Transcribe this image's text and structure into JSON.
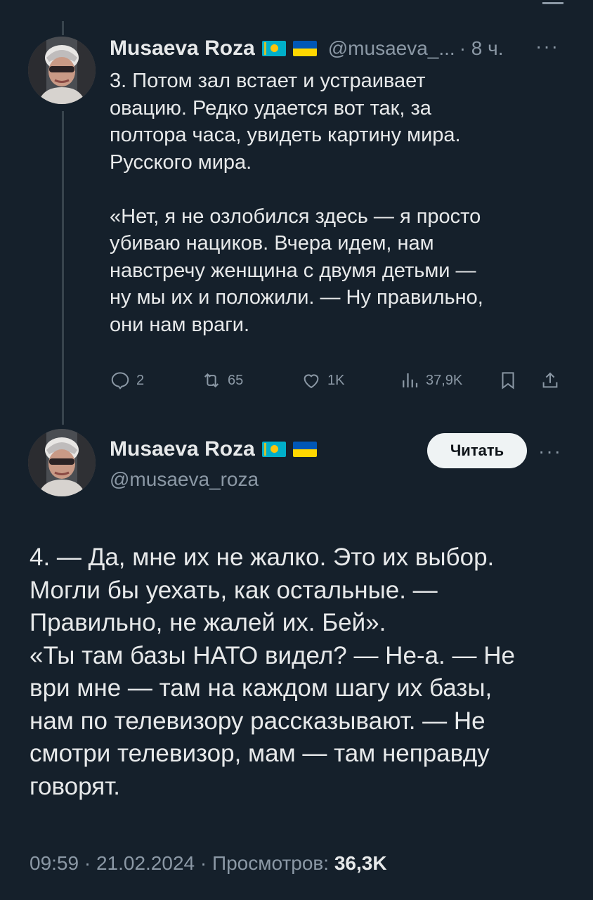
{
  "reply_tweet": {
    "author_name": "Musaeva Roza",
    "handle": "@musaeva_...",
    "time": "· 8 ч.",
    "more": "···",
    "text": "3. Потом зал встает и устраивает\nовацию. Редко удается вот так, за\nполтора часа, увидеть картину мира.\nРусского мира.\n\n«Нет, я не озлобился здесь — я просто\nубиваю нациков. Вчера идем, нам\nнавстречу женщина с двумя детьми —\nну мы их и положили. — Ну правильно,\nони нам враги.",
    "actions": {
      "replies": "2",
      "retweets": "65",
      "likes": "1K",
      "views": "37,9K"
    }
  },
  "main_tweet": {
    "author_name": "Musaeva Roza",
    "handle": "@musaeva_roza",
    "follow_label": "Читать",
    "more": "···",
    "text": "4. — Да, мне их не жалко. Это их выбор.\nМогли бы уехать, как остальные. —\nПравильно, не жалей их. Бей».\n«Ты там базы НАТО видел? — Не-а. — Не\nври мне — там на каждом шагу их базы,\nнам по телевизору рассказывают. — Не\nсмотри телевизор, мам — там неправду\nговорят.",
    "timestamp": "09:59 · 21.02.2024 · Просмотров: ",
    "views": "36,3K"
  },
  "icons": {
    "reply": "reply-icon",
    "retweet": "retweet-icon",
    "like": "heart-icon",
    "views": "views-icon",
    "bookmark": "bookmark-icon",
    "share": "share-icon"
  },
  "colors": {
    "background": "#15202b",
    "text": "#e7e9ea",
    "muted": "#8b98a5",
    "follow_button_bg": "#eff3f4"
  }
}
